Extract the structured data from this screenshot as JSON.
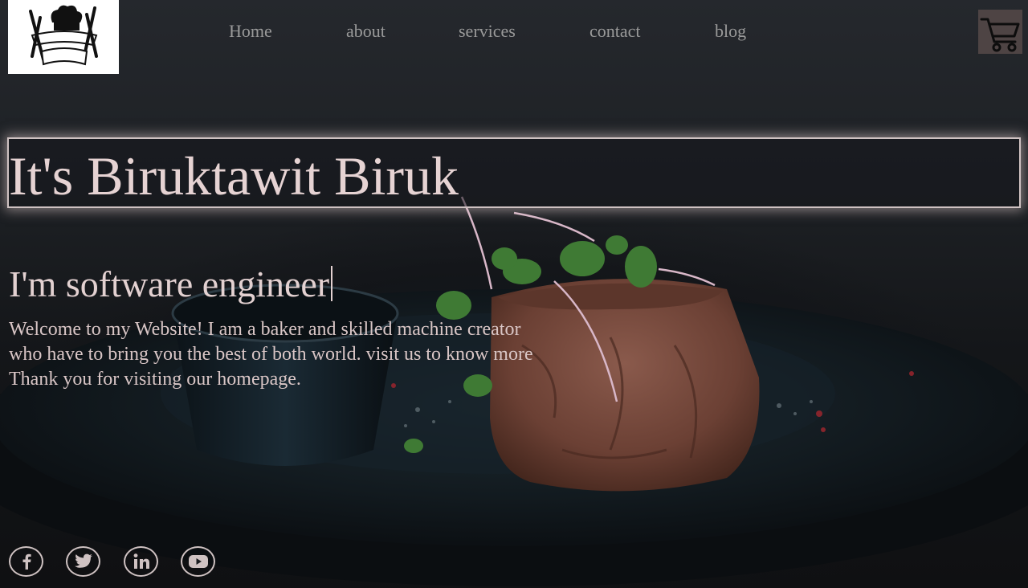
{
  "nav": {
    "items": [
      {
        "label": "Home"
      },
      {
        "label": "about"
      },
      {
        "label": "services"
      },
      {
        "label": "contact"
      },
      {
        "label": "blog"
      }
    ]
  },
  "hero": {
    "title": "It's Biruktawit Biruk",
    "subtitle": "I'm software engineer",
    "welcome_lines": [
      "Welcome to my Website! I am a baker and skilled machine creator",
      "who have to bring you the best of both world. visit us to know more",
      "Thank you for visiting our homepage."
    ]
  },
  "icons": {
    "logo": "chef-hat-logo-icon",
    "cart": "shopping-cart-icon",
    "social": [
      "facebook-icon",
      "twitter-icon",
      "linkedin-icon",
      "youtube-icon"
    ]
  },
  "colors": {
    "nav_text": "#9a9a9a",
    "title_text": "#e6d3d3",
    "title_border": "#cfc2c2",
    "cart_bg": "#4e4444",
    "background": "#121417"
  }
}
